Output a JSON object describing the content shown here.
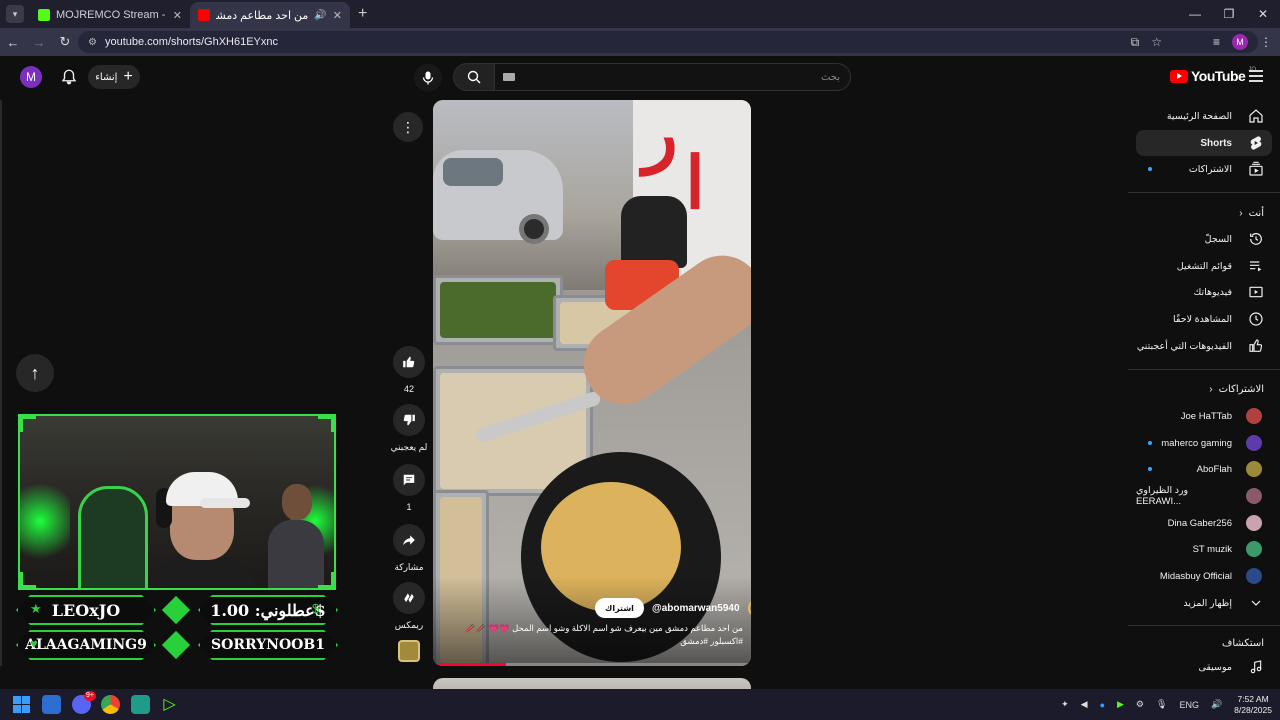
{
  "browser": {
    "tabs": [
      {
        "title": "MOJREMCO Stream - Watch Li",
        "active": false,
        "favicon_color": "#53fc18"
      },
      {
        "title": "من احد مطاعم دمشق مين بي",
        "active": true,
        "favicon_color": "#ff0000"
      }
    ],
    "url": "youtube.com/shorts/GhXH61EYxnc",
    "profile_initial": "M"
  },
  "header": {
    "avatar_initial": "M",
    "create_label": "إنشاء",
    "search_placeholder": "بحث",
    "logo_text": "YouTube",
    "logo_country": "JO"
  },
  "shorts": {
    "likes": "42",
    "dislike_label": "لم يعجبني",
    "comments": "1",
    "share_label": "مشاركة",
    "remix_label": "ريمكس",
    "channel_handle": "@abomarwan5940",
    "subscribe_label": "اشتراك",
    "caption": "من احد مطاعم دمشق مين بيعرف شو اسم الاكلة وشو اسم المحل 💗💗 🥢🥢 #اكسبلور #دمشق",
    "progress_fraction": 0.23
  },
  "stream_overlay": {
    "names": [
      "LEOxJO",
      "عطلوني: 1.00$",
      "ALAAGAMING9",
      "SORRYNOOB1"
    ],
    "accent_color": "#39e04a"
  },
  "sidebar": {
    "main": [
      {
        "label": "الصفحة الرئيسية",
        "icon": "home-icon",
        "active": false
      },
      {
        "label": "Shorts",
        "icon": "shorts-icon",
        "active": true
      },
      {
        "label": "الاشتراكات",
        "icon": "subscriptions-icon",
        "active": false,
        "dot": true
      }
    ],
    "you_header": "أنت",
    "you": [
      {
        "label": "السجلّ",
        "icon": "history-icon"
      },
      {
        "label": "قوائم التشغيل",
        "icon": "playlist-icon"
      },
      {
        "label": "فيديوهاتك",
        "icon": "your-videos-icon"
      },
      {
        "label": "المشاهدة لاحقًا",
        "icon": "watch-later-icon"
      },
      {
        "label": "الفيديوهات التي أعجبتني",
        "icon": "liked-icon"
      }
    ],
    "subs_header": "الاشتراكات",
    "subs": [
      {
        "label": "Joe HaTTab",
        "dot": false,
        "color": "#b0413e"
      },
      {
        "label": "maherco gaming",
        "dot": true,
        "color": "#5c3ca8"
      },
      {
        "label": "AboFlah",
        "dot": true,
        "color": "#9a8a3a"
      },
      {
        "label": "ورد الظيراوي EERAWI...",
        "dot": false,
        "color": "#8a5a6a"
      },
      {
        "label": "Dina Gaber256",
        "dot": false,
        "color": "#c9a3b0"
      },
      {
        "label": "ST muzik",
        "dot": false,
        "color": "#3a9a6a"
      },
      {
        "label": "Midasbuy Official",
        "dot": false,
        "color": "#2a4a8a"
      }
    ],
    "show_more": "إظهار المزيد",
    "explore_header": "استكشاف",
    "explore": [
      {
        "label": "موسيقى",
        "icon": "music-icon"
      }
    ]
  },
  "taskbar": {
    "discord_badge": "9+",
    "lang": "ENG",
    "time": "7:52 AM",
    "date": "8/28/2025"
  }
}
